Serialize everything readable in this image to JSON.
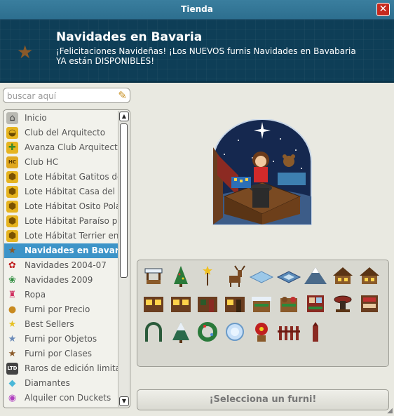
{
  "window": {
    "title": "Tienda",
    "close_label": "✕"
  },
  "banner": {
    "title": "Navidades en Bavaria",
    "text": "¡Felicitaciones Navideñas! ¡Los NUEVOS furnis Navidades en Bavabaria YA están DISPONIBLES!",
    "icon": "star-icon"
  },
  "search": {
    "placeholder": "buscar aquí"
  },
  "nav": {
    "items": [
      {
        "label": "Inicio",
        "icon": "house-icon"
      },
      {
        "label": "Club del Arquitecto",
        "icon": "builder-helmet-icon"
      },
      {
        "label": "Avanza Club Arquitecto",
        "icon": "builder-plus-icon"
      },
      {
        "label": "Club HC",
        "icon": "hc-icon"
      },
      {
        "label": "Lote Hábitat Gatitos de",
        "icon": "bundle-icon"
      },
      {
        "label": "Lote Hábitat Casa del Ce",
        "icon": "bundle-icon"
      },
      {
        "label": "Lote Hábitat Osito Polar",
        "icon": "bundle-icon"
      },
      {
        "label": "Lote Hábitat Paraíso par",
        "icon": "bundle-icon"
      },
      {
        "label": "Lote Hábitat Terrier en",
        "icon": "bundle-icon"
      },
      {
        "label": "Navidades en Bavaria",
        "icon": "star-icon",
        "selected": true
      },
      {
        "label": "Navidades 2004-07",
        "icon": "bow-icon"
      },
      {
        "label": "Navidades 2009",
        "icon": "wreath-icon"
      },
      {
        "label": "Ropa",
        "icon": "clothing-icon"
      },
      {
        "label": "Furni por Precio",
        "icon": "coins-icon"
      },
      {
        "label": "Best Sellers",
        "icon": "star-icon"
      },
      {
        "label": "Furni por Objetos",
        "icon": "star-icon"
      },
      {
        "label": "Furni por Clases",
        "icon": "star-icon"
      },
      {
        "label": "Raros de edición limitad",
        "icon": "ltd-icon"
      },
      {
        "label": "Diamantes",
        "icon": "diamond-icon"
      },
      {
        "label": "Alquiler con Duckets",
        "icon": "ducket-icon"
      }
    ]
  },
  "furni": [
    "market-stall-icon",
    "christmas-tree-icon",
    "star-wand-icon",
    "reindeer-icon",
    "ice-tile-icon",
    "blue-tile-icon",
    "snowy-mountain-icon",
    "wooden-house-icon",
    "wooden-house-icon",
    "window-panel-icon",
    "window-panel-icon",
    "door-panel-icon",
    "window-door-panel-icon",
    "snowy-stall-icon",
    "toy-stall-icon",
    "shelf-stall-icon",
    "grill-icon",
    "shelf-icon",
    "arch-icon",
    "pine-tree-icon",
    "wreath-icon",
    "ice-disc-icon",
    "poinsettia-icon",
    "fence-icon",
    "post-icon"
  ],
  "select_button": {
    "label": "¡Selecciona un furni!"
  },
  "colors": {
    "titlebar": "#2d6f8f",
    "banner": "#0e3e57",
    "selected": "#3d94c8",
    "close": "#c62a1e"
  }
}
